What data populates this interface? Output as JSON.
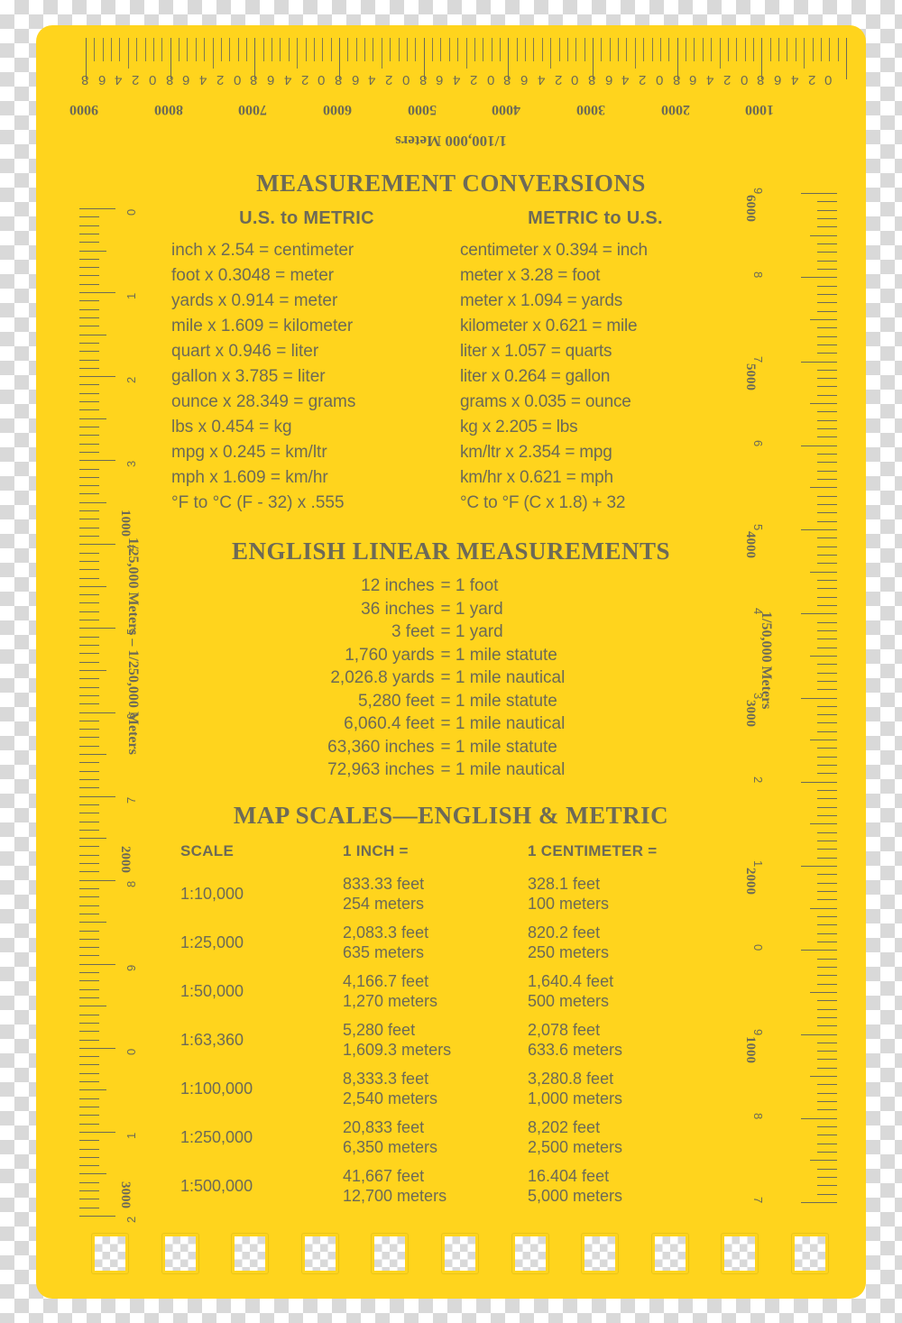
{
  "card": {
    "accent_color": "#FFD41D",
    "text_color": "#6d6a57"
  },
  "top_ruler": {
    "title": "1/100,000 Meters",
    "major_labels": [
      "1000",
      "2000",
      "3000",
      "4000",
      "5000",
      "6000",
      "7000",
      "8000",
      "9000"
    ],
    "minor_labels": [
      "0",
      "2",
      "4",
      "6",
      "8"
    ]
  },
  "left_ruler": {
    "title": "1/25,000 Meters – 1/250,000 Meters",
    "major_labels": [
      "1000",
      "2000",
      "3000"
    ],
    "minor_labels": [
      "0",
      "1",
      "2",
      "3",
      "4",
      "5",
      "6",
      "7",
      "8",
      "9"
    ]
  },
  "right_ruler": {
    "title": "1/50,000 Meters",
    "major_labels": [
      "6000",
      "5000",
      "4000",
      "3000",
      "2000",
      "1000"
    ],
    "minor_labels": [
      "0",
      "1",
      "2",
      "3",
      "4",
      "5",
      "6",
      "7",
      "8",
      "9"
    ]
  },
  "sections": {
    "conversions": {
      "title": "MEASUREMENT  CONVERSIONS",
      "us_to_metric": {
        "heading": "U.S. to METRIC",
        "lines": [
          "inch x 2.54 = centimeter",
          "foot x 0.3048 = meter",
          "yards x 0.914 = meter",
          "mile x 1.609 = kilometer",
          "quart x 0.946 = liter",
          "gallon x 3.785 = liter",
          "ounce x 28.349 = grams",
          "lbs x 0.454 = kg",
          "mpg x 0.245 = km/ltr",
          "mph x 1.609 = km/hr",
          "°F to °C  (F - 32) x .555"
        ]
      },
      "metric_to_us": {
        "heading": "METRIC to U.S.",
        "lines": [
          "centimeter x 0.394 = inch",
          "meter x 3.28 = foot",
          "meter x 1.094 = yards",
          "kilometer x 0.621 = mile",
          "liter x 1.057 = quarts",
          "liter x 0.264 = gallon",
          "grams x 0.035 = ounce",
          "kg x 2.205 = lbs",
          "km/ltr x 2.354 = mpg",
          "km/hr x 0.621 = mph",
          "°C to °F  (C x 1.8) + 32"
        ]
      }
    },
    "english_linear": {
      "title": "ENGLISH LINEAR MEASUREMENTS",
      "rows": [
        {
          "q": "12 inches",
          "a": "= 1 foot"
        },
        {
          "q": "36 inches",
          "a": "= 1 yard"
        },
        {
          "q": "3 feet",
          "a": "= 1 yard"
        },
        {
          "q": "1,760 yards",
          "a": "= 1 mile statute"
        },
        {
          "q": "2,026.8 yards",
          "a": "= 1 mile nautical"
        },
        {
          "q": "5,280 feet",
          "a": "= 1 mile statute"
        },
        {
          "q": "6,060.4 feet",
          "a": "= 1 mile nautical"
        },
        {
          "q": "63,360 inches",
          "a": "= 1 mile statute"
        },
        {
          "q": "72,963 inches",
          "a": "= 1 mile nautical"
        }
      ]
    },
    "map_scales": {
      "title": "MAP SCALES—ENGLISH & METRIC",
      "headers": [
        "SCALE",
        "1 INCH =",
        "1 CENTIMETER ="
      ],
      "rows": [
        {
          "scale": "1:10,000",
          "inch_a": "833.33 feet",
          "inch_b": "254 meters",
          "cm_a": "328.1 feet",
          "cm_b": "100 meters"
        },
        {
          "scale": "1:25,000",
          "inch_a": "2,083.3 feet",
          "inch_b": "635 meters",
          "cm_a": "820.2 feet",
          "cm_b": "250 meters"
        },
        {
          "scale": "1:50,000",
          "inch_a": "4,166.7 feet",
          "inch_b": "1,270 meters",
          "cm_a": "1,640.4 feet",
          "cm_b": "500 meters"
        },
        {
          "scale": "1:63,360",
          "inch_a": "5,280 feet",
          "inch_b": "1,609.3 meters",
          "cm_a": "2,078 feet",
          "cm_b": "633.6 meters"
        },
        {
          "scale": "1:100,000",
          "inch_a": "8,333.3 feet",
          "inch_b": "2,540 meters",
          "cm_a": "3,280.8 feet",
          "cm_b": "1,000 meters"
        },
        {
          "scale": "1:250,000",
          "inch_a": "20,833 feet",
          "inch_b": "6,350 meters",
          "cm_a": "8,202 feet",
          "cm_b": "2,500 meters"
        },
        {
          "scale": "1:500,000",
          "inch_a": "41,667 feet",
          "inch_b": "12,700 meters",
          "cm_a": "16.404 feet",
          "cm_b": "5,000 meters"
        }
      ]
    }
  }
}
